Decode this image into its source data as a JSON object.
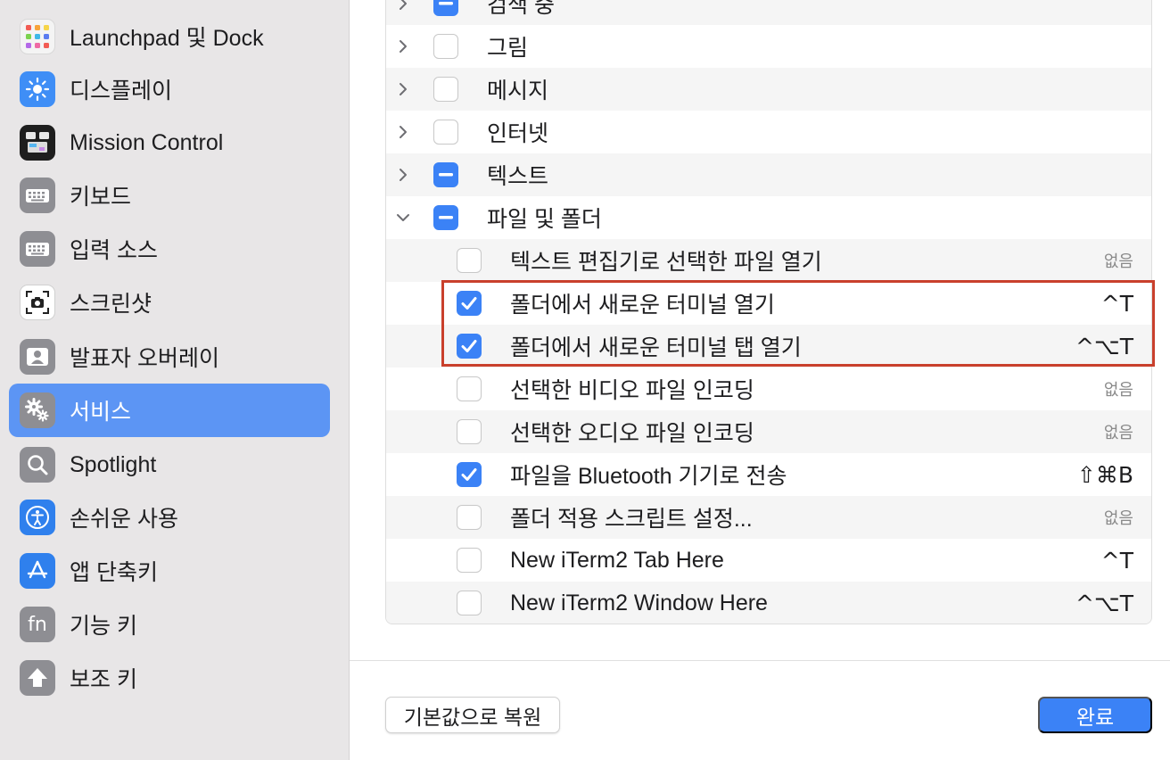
{
  "sidebar": {
    "items": [
      {
        "label": "Launchpad 및 Dock",
        "icon": "launchpad-icon"
      },
      {
        "label": "디스플레이",
        "icon": "display-icon"
      },
      {
        "label": "Mission Control",
        "icon": "mission-control-icon"
      },
      {
        "label": "키보드",
        "icon": "keyboard-icon"
      },
      {
        "label": "입력 소스",
        "icon": "input-source-icon"
      },
      {
        "label": "스크린샷",
        "icon": "screenshot-icon"
      },
      {
        "label": "발표자 오버레이",
        "icon": "presenter-overlay-icon"
      },
      {
        "label": "서비스",
        "icon": "services-gear-icon",
        "selected": true
      },
      {
        "label": "Spotlight",
        "icon": "spotlight-icon"
      },
      {
        "label": "손쉬운 사용",
        "icon": "accessibility-icon"
      },
      {
        "label": "앱 단축키",
        "icon": "app-shortcuts-icon"
      },
      {
        "label": "기능 키",
        "icon": "function-key-icon"
      },
      {
        "label": "보조 키",
        "icon": "modifier-keys-icon"
      }
    ]
  },
  "services": {
    "categories": [
      {
        "label": "검색 중",
        "state": "mixed",
        "expanded": false
      },
      {
        "label": "그림",
        "state": "off",
        "expanded": false
      },
      {
        "label": "메시지",
        "state": "off",
        "expanded": false
      },
      {
        "label": "인터넷",
        "state": "off",
        "expanded": false
      },
      {
        "label": "텍스트",
        "state": "mixed",
        "expanded": false
      },
      {
        "label": "파일 및 폴더",
        "state": "mixed",
        "expanded": true
      }
    ],
    "items": [
      {
        "label": "텍스트 편집기로 선택한 파일 열기",
        "checked": false,
        "shortcut": "없음"
      },
      {
        "label": "폴더에서 새로운 터미널 열기",
        "checked": true,
        "shortcut": "^T"
      },
      {
        "label": "폴더에서 새로운 터미널 탭 열기",
        "checked": true,
        "shortcut": "^⌥T"
      },
      {
        "label": "선택한 비디오 파일 인코딩",
        "checked": false,
        "shortcut": "없음"
      },
      {
        "label": "선택한 오디오 파일 인코딩",
        "checked": false,
        "shortcut": "없음"
      },
      {
        "label": "파일을 Bluetooth 기기로 전송",
        "checked": true,
        "shortcut": "⇧⌘B"
      },
      {
        "label": "폴더 적용 스크립트 설정...",
        "checked": false,
        "shortcut": "없음"
      },
      {
        "label": "New iTerm2 Tab Here",
        "checked": false,
        "shortcut": "^T"
      },
      {
        "label": "New iTerm2 Window Here",
        "checked": false,
        "shortcut": "^⌥T"
      }
    ]
  },
  "footer": {
    "restore_label": "기본값으로 복원",
    "done_label": "완료"
  },
  "colors": {
    "accent": "#3b82f6",
    "sidebar_selected": "#5c95f4",
    "highlight_border": "#c9402c"
  }
}
